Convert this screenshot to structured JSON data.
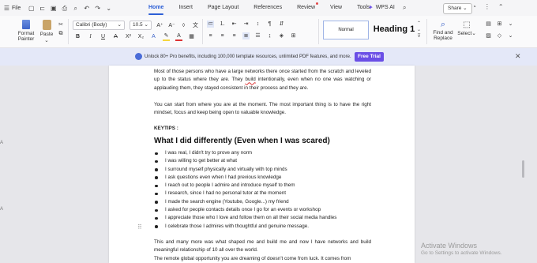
{
  "menubar": {
    "file_label": "File",
    "tabs": [
      {
        "label": "Home",
        "active": true
      },
      {
        "label": "Insert",
        "active": false
      },
      {
        "label": "Page Layout",
        "active": false
      },
      {
        "label": "References",
        "active": false
      },
      {
        "label": "Review",
        "active": false,
        "dot": true
      },
      {
        "label": "View",
        "active": false
      },
      {
        "label": "Tools",
        "active": false
      }
    ],
    "wps_ai_label": "WPS AI",
    "share_label": "Share"
  },
  "ribbon": {
    "format_painter_label": "Format Painter",
    "paste_label": "Paste",
    "font_name": "Calibri (Body)",
    "font_size": "10.5",
    "style_normal": "Normal",
    "style_heading": "Heading 1",
    "find_replace_label": "Find and Replace",
    "select_label": "Select"
  },
  "banner": {
    "text": "Unlock 80+ Pro benefits, including 100,000 template resources, unlimited PDF features, and more.",
    "button_label": "Free Trial",
    "accent": "#6a4ee6"
  },
  "document": {
    "para1_before": "Most of those persons who have a large networks there once started from the scratch and leveled up to the status where they are. They ",
    "para1_misspelled": "build",
    "para1_after": " intentionally, even when no one was watching or applauding them, they stayed consistent in their process and they are.",
    "para2": "You can start from where you are at the moment. The most important thing is to have the right mindset, focus and keep being open to valuable knowledge.",
    "keytips": "KEYTIPS :",
    "heading": "What I did differently (Even when I was scared)",
    "bullets": [
      "I was real, I didn't try to prove any norm",
      "I was willing to get better at what",
      "I surround myself physically and virtually with top minds",
      "I ask questions even when I had previous knowledge",
      "I reach out to people I admire and introduce myself to them",
      "I research, since I had no personal tutor at the moment",
      "I made the search engine (Youtube, Google...) my friend",
      "I asked for people contacts details once I go for an events or workshop",
      "I appreciate those who I love and follow them on all their social media handles",
      "I celebrate those I admires with thoughtful and genuine message."
    ],
    "para3": "This and many more was what shaped me and build me and now I have networks and build meaningful relationship of 10 all over the world.",
    "para4": "The remote global opportunity you are dreaming of doesn't come from luck. It comes from"
  },
  "watermark": {
    "title": "Activate Windows",
    "subtitle": "Go to Settings to activate Windows."
  }
}
